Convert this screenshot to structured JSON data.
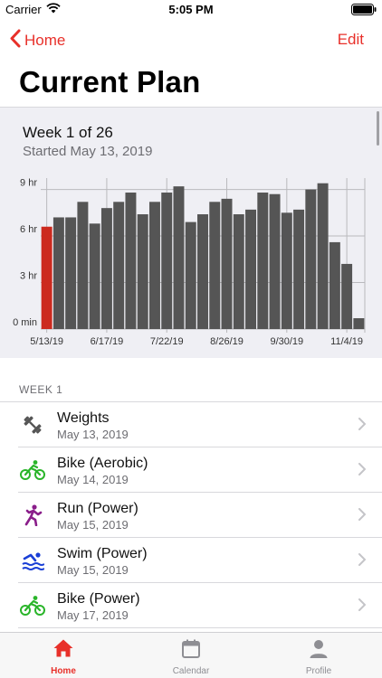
{
  "status": {
    "carrier": "Carrier",
    "time": "5:05 PM"
  },
  "nav": {
    "back_label": "Home",
    "edit_label": "Edit"
  },
  "page_title": "Current Plan",
  "plan": {
    "week_label": "Week 1 of 26",
    "started_label": "Started May 13, 2019"
  },
  "chart_data": {
    "type": "bar",
    "y_unit": "hours",
    "ylim": [
      0,
      9.5
    ],
    "y_ticks": [
      {
        "value": 0,
        "label": "0 min"
      },
      {
        "value": 3,
        "label": "3 hr"
      },
      {
        "value": 6,
        "label": "6 hr"
      },
      {
        "value": 9,
        "label": "9 hr"
      }
    ],
    "x_tick_labels": [
      "5/13/19",
      "6/17/19",
      "7/22/19",
      "8/26/19",
      "9/30/19",
      "11/4/19"
    ],
    "x_tick_indices": [
      0,
      5,
      10,
      15,
      20,
      25
    ],
    "values": [
      6.6,
      7.2,
      7.2,
      8.2,
      6.8,
      7.8,
      8.2,
      8.8,
      7.4,
      8.2,
      8.8,
      9.2,
      6.9,
      7.4,
      8.2,
      8.4,
      7.4,
      7.7,
      8.8,
      8.7,
      7.5,
      7.7,
      9.0,
      9.4,
      5.6,
      4.2,
      0.7
    ],
    "highlight_index": 0,
    "bar_color": "#555555",
    "highlight_color": "#cc2a1e"
  },
  "section_header": "WEEK 1",
  "workouts": [
    {
      "title": "Weights",
      "date": "May 13, 2019",
      "icon": "dumbbell-icon",
      "color": "#555555"
    },
    {
      "title": "Bike (Aerobic)",
      "date": "May 14, 2019",
      "icon": "bike-icon",
      "color": "#2ab52a"
    },
    {
      "title": "Run (Power)",
      "date": "May 15, 2019",
      "icon": "runner-icon",
      "color": "#8a1e8a"
    },
    {
      "title": "Swim (Power)",
      "date": "May 15, 2019",
      "icon": "swim-icon",
      "color": "#1a3fd6"
    },
    {
      "title": "Bike (Power)",
      "date": "May 17, 2019",
      "icon": "bike-icon",
      "color": "#2ab52a"
    }
  ],
  "tabs": [
    {
      "label": "Home",
      "icon": "home-icon",
      "active": true
    },
    {
      "label": "Calendar",
      "icon": "calendar-icon",
      "active": false
    },
    {
      "label": "Profile",
      "icon": "profile-icon",
      "active": false
    }
  ],
  "colors": {
    "accent": "#e8302a",
    "panel_bg": "#efeff4"
  }
}
